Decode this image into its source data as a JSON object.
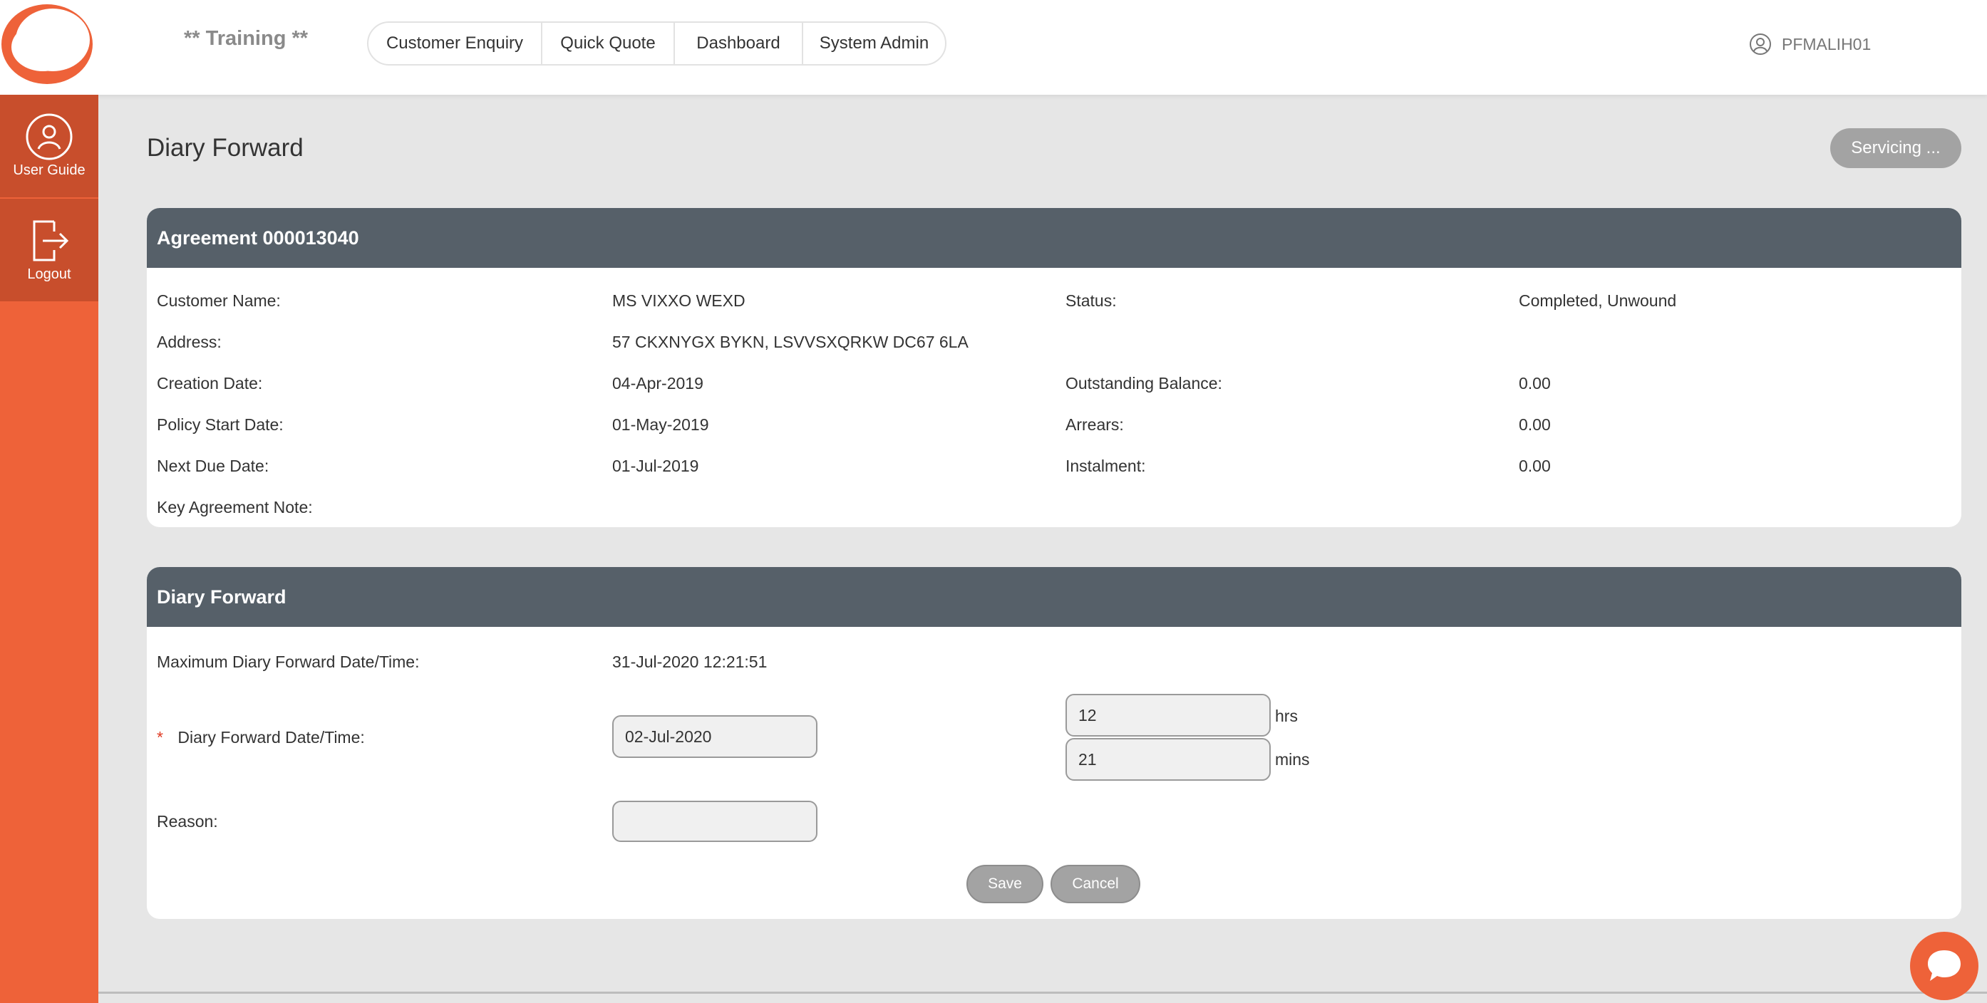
{
  "header": {
    "environment_label": "** Training **",
    "nav": [
      {
        "label": "Customer Enquiry"
      },
      {
        "label": "Quick Quote"
      },
      {
        "label": "Dashboard"
      },
      {
        "label": "System Admin"
      }
    ],
    "user_icon": "user-circle-icon",
    "username": "PFMALIH01"
  },
  "sidebar": {
    "user_guide_label": "User Guide",
    "logout_label": "Logout"
  },
  "page": {
    "title": "Diary Forward",
    "servicing_label": "Servicing ..."
  },
  "agreement": {
    "heading": "Agreement 000013040",
    "customer_name_label": "Customer Name:",
    "customer_name": "MS VIXXO WEXD",
    "status_label": "Status:",
    "status": "Completed, Unwound",
    "address_label": "Address:",
    "address": "57 CKXNYGX BYKN, LSVVSXQRKW DC67 6LA",
    "creation_date_label": "Creation Date:",
    "creation_date": "04-Apr-2019",
    "outstanding_balance_label": "Outstanding Balance:",
    "outstanding_balance": "0.00",
    "policy_start_label": "Policy Start Date:",
    "policy_start": "01-May-2019",
    "arrears_label": "Arrears:",
    "arrears": "0.00",
    "next_due_label": "Next Due Date:",
    "next_due": "01-Jul-2019",
    "instalment_label": "Instalment:",
    "instalment": "0.00",
    "key_note_label": "Key Agreement Note:"
  },
  "diary": {
    "heading": "Diary Forward",
    "max_label": "Maximum Diary Forward Date/Time:",
    "max_value": "31-Jul-2020 12:21:51",
    "required_mark": "*",
    "date_label": "Diary Forward Date/Time:",
    "date_value": "02-Jul-2020",
    "hours_value": "12",
    "hours_unit": "hrs",
    "mins_value": "21",
    "mins_unit": "mins",
    "reason_label": "Reason:",
    "reason_value": "",
    "save_label": "Save",
    "cancel_label": "Cancel"
  },
  "colors": {
    "brand_orange": "#ee6239",
    "sidebar_button": "#c84e2c",
    "panel_header": "#566069",
    "button_grey": "#a3a3a3"
  }
}
